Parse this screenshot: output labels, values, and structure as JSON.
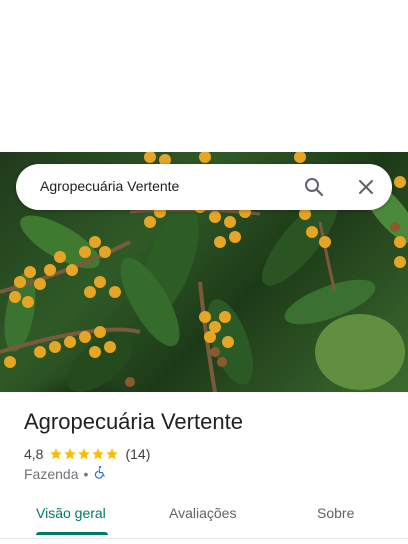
{
  "search": {
    "query": "Agropecuária Vertente"
  },
  "place": {
    "name": "Agropecuária Vertente",
    "rating": "4,8",
    "stars": 5,
    "review_count": "(14)",
    "category": "Fazenda",
    "separator": "•",
    "accessibility_icon": "wheelchair-accessible-icon"
  },
  "tabs": [
    {
      "label": "Visão geral",
      "active": true
    },
    {
      "label": "Avaliações",
      "active": false
    },
    {
      "label": "Sobre",
      "active": false
    }
  ],
  "colors": {
    "accent": "#00796b",
    "star": "#fbbc04",
    "accessibility": "#1a73e8"
  }
}
